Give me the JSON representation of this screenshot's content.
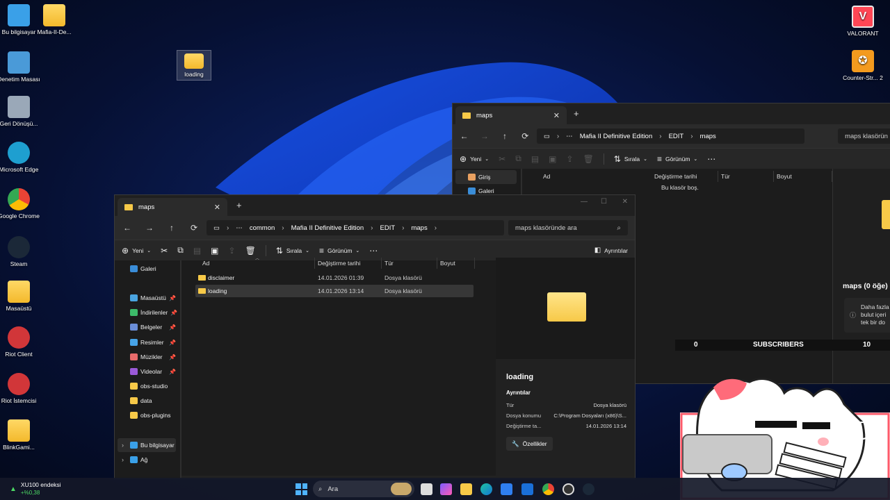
{
  "desktop": {
    "icons_left": [
      {
        "label": "Bu bilgisayar",
        "icon": "computer-icon"
      },
      {
        "label": "Mafia-II-De...",
        "icon": "folder-icon"
      },
      {
        "label": "Denetim Masası",
        "icon": "control-panel-icon"
      },
      {
        "label": "Geri Dönüşü...",
        "icon": "recycle-bin-icon"
      },
      {
        "label": "Microsoft Edge",
        "icon": "edge-icon"
      },
      {
        "label": "Google Chrome",
        "icon": "chrome-icon"
      },
      {
        "label": "Steam",
        "icon": "steam-icon"
      },
      {
        "label": "Masaüstü",
        "icon": "folder-icon"
      },
      {
        "label": "Riot Client",
        "icon": "riot-icon"
      },
      {
        "label": "Riot İstemcisi",
        "icon": "riot-icon"
      },
      {
        "label": "BlinkGami...",
        "icon": "folder-icon"
      }
    ],
    "loading_icon": "loading",
    "icons_right": [
      {
        "label": "VALORANT",
        "icon": "valorant-icon"
      },
      {
        "label": "Counter-Str... 2",
        "icon": "counter-strike-icon"
      }
    ]
  },
  "back_window": {
    "tab_title": "maps",
    "breadcrumb": [
      "Mafia II Definitive Edition",
      "EDIT",
      "maps"
    ],
    "search_placeholder": "maps klasörün",
    "commands": {
      "new": "Yeni",
      "sort": "Sırala",
      "view": "Görünüm"
    },
    "nav": [
      "Giriş",
      "Galeri"
    ],
    "columns": [
      "Ad",
      "Değiştirme tarihi",
      "Tür",
      "Boyut"
    ],
    "empty_text": "Bu klasör boş.",
    "side_title": "maps (0 öğe)",
    "side_info": [
      "Daha fazla",
      "bulut içeri",
      "tek bir do"
    ],
    "stream_bar": {
      "left": "0",
      "center": "SUBSCRIBERS",
      "right": "10"
    }
  },
  "front_window": {
    "tab_title": "maps",
    "breadcrumb": [
      "common",
      "Mafia II Definitive Edition",
      "EDIT",
      "maps"
    ],
    "search_placeholder": "maps klasöründe ara",
    "commands": {
      "new": "Yeni",
      "sort": "Sırala",
      "view": "Görünüm",
      "details": "Ayrıntılar"
    },
    "nav": [
      {
        "label": "Galeri",
        "pin": false
      },
      {
        "label": "Masaüstü",
        "pin": true
      },
      {
        "label": "İndirilenler",
        "pin": true
      },
      {
        "label": "Belgeler",
        "pin": true
      },
      {
        "label": "Resimler",
        "pin": true
      },
      {
        "label": "Müzikler",
        "pin": true
      },
      {
        "label": "Videolar",
        "pin": true
      },
      {
        "label": "obs-studio",
        "pin": false
      },
      {
        "label": "data",
        "pin": false
      },
      {
        "label": "obs-plugins",
        "pin": false
      },
      {
        "label": "Bu bilgisayar",
        "pin": false
      },
      {
        "label": "Ağ",
        "pin": false
      }
    ],
    "columns": [
      "Ad",
      "Değiştirme tarihi",
      "Tür",
      "Boyut"
    ],
    "rows": [
      {
        "name": "disclaimer",
        "date": "14.01.2026 01:39",
        "type": "Dosya klasörü"
      },
      {
        "name": "loading",
        "date": "14.01.2026 13:14",
        "type": "Dosya klasörü"
      }
    ],
    "details": {
      "name": "loading",
      "section": "Ayrıntılar",
      "fields": [
        {
          "k": "Tür",
          "v": "Dosya klasörü"
        },
        {
          "k": "Dosya konumu",
          "v": "C:\\Program Dosyaları (x86)\\S..."
        },
        {
          "k": "Değiştirme ta...",
          "v": "14.01.2026 13:14"
        }
      ],
      "properties_button": "Özellikler"
    }
  },
  "taskbar": {
    "widget_title": "XU100 endeksi",
    "widget_value": "+%0,38",
    "search_placeholder": "Ara"
  }
}
